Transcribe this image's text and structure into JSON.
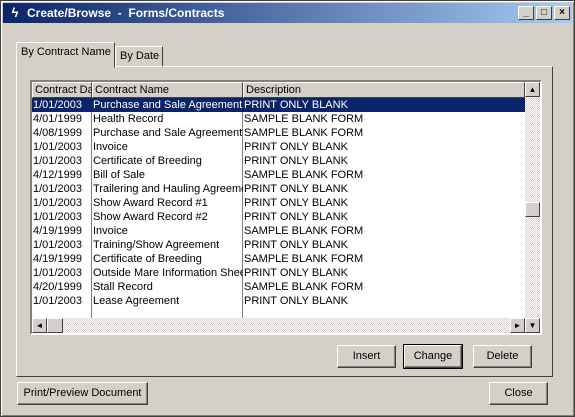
{
  "window": {
    "title": "Create/Browse  -  Forms/Contracts",
    "icon": "app-lightning-icon",
    "controls": {
      "minimize": "_",
      "maximize": "□",
      "close": "×"
    }
  },
  "tabs": [
    {
      "label": "By Contract Name",
      "active": true
    },
    {
      "label": "By Date",
      "active": false
    }
  ],
  "list": {
    "columns": [
      "Contract Date",
      "Contract Name",
      "Description"
    ],
    "rows": [
      {
        "date": "1/01/2003",
        "name": "Purchase and Sale Agreement",
        "desc": "PRINT ONLY BLANK",
        "selected": true
      },
      {
        "date": "4/01/1999",
        "name": "Health Record",
        "desc": "SAMPLE BLANK FORM"
      },
      {
        "date": "4/08/1999",
        "name": "Purchase and Sale Agreement",
        "desc": "SAMPLE BLANK FORM"
      },
      {
        "date": "1/01/2003",
        "name": "Invoice",
        "desc": "PRINT ONLY BLANK"
      },
      {
        "date": "1/01/2003",
        "name": "Certificate of Breeding",
        "desc": "PRINT ONLY BLANK"
      },
      {
        "date": "4/12/1999",
        "name": "Bill of Sale",
        "desc": "SAMPLE BLANK FORM"
      },
      {
        "date": "1/01/2003",
        "name": "Trailering and Hauling Agreement",
        "desc": "PRINT ONLY BLANK"
      },
      {
        "date": "1/01/2003",
        "name": "Show Award Record #1",
        "desc": "PRINT ONLY BLANK"
      },
      {
        "date": "1/01/2003",
        "name": "Show Award Record #2",
        "desc": "PRINT ONLY BLANK"
      },
      {
        "date": "4/19/1999",
        "name": "Invoice",
        "desc": "SAMPLE BLANK FORM"
      },
      {
        "date": "1/01/2003",
        "name": "Training/Show Agreement",
        "desc": "PRINT ONLY BLANK"
      },
      {
        "date": "4/19/1999",
        "name": "Certificate of Breeding",
        "desc": "SAMPLE BLANK FORM"
      },
      {
        "date": "1/01/2003",
        "name": "Outside Mare Information Sheet",
        "desc": "PRINT ONLY BLANK"
      },
      {
        "date": "4/20/1999",
        "name": "Stall Record",
        "desc": "SAMPLE BLANK FORM"
      },
      {
        "date": "1/01/2003",
        "name": "Lease Agreement",
        "desc": "PRINT ONLY BLANK"
      }
    ]
  },
  "scroll": {
    "up": "▲",
    "down": "▼",
    "left": "◄",
    "right": "►"
  },
  "buttons": {
    "insert": "Insert",
    "change": "Change",
    "delete": "Delete",
    "print_preview": "Print/Preview Document",
    "close": "Close"
  },
  "colors": {
    "title_gradient_start": "#0a246a",
    "title_gradient_end": "#a6caf0",
    "selection": "#0a246a",
    "face": "#d4d0c8"
  }
}
